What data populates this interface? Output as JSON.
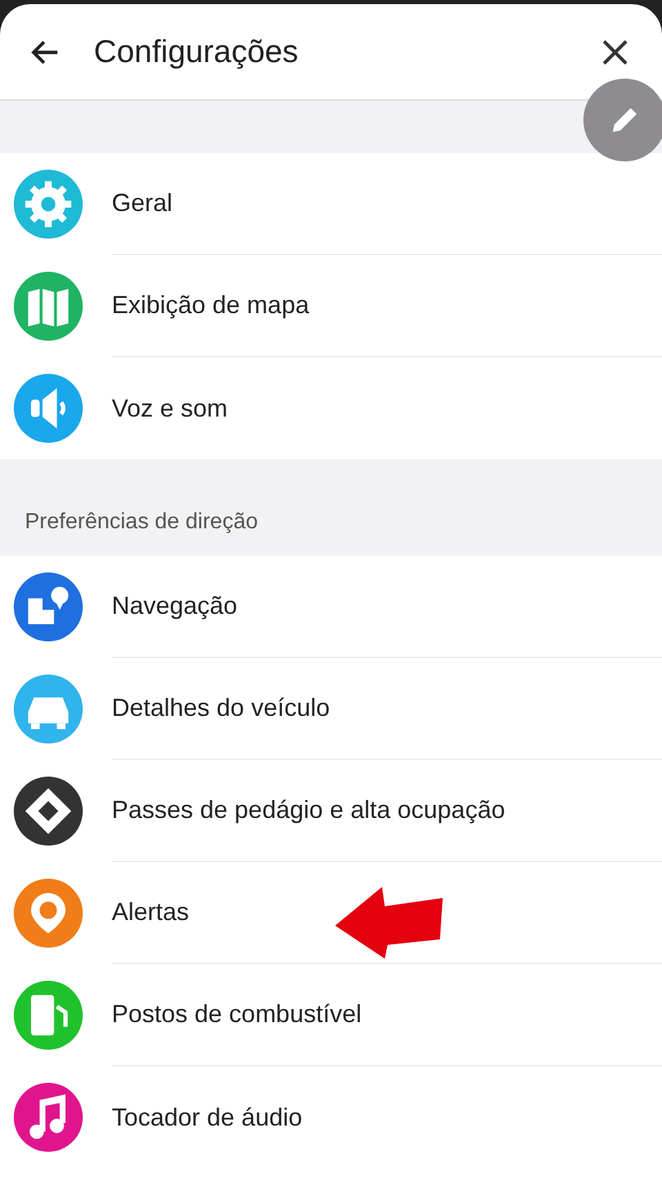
{
  "header": {
    "title": "Configurações"
  },
  "sections": [
    {
      "items": [
        {
          "label": "Geral",
          "color": "#1fbad6"
        },
        {
          "label": "Exibição de mapa",
          "color": "#1fb463"
        },
        {
          "label": "Voz e som",
          "color": "#1aa7ec"
        }
      ]
    },
    {
      "title": "Preferências de direção",
      "items": [
        {
          "label": "Navegação",
          "color": "#1f6fe0"
        },
        {
          "label": "Detalhes do veículo",
          "color": "#30b4ec"
        },
        {
          "label": "Passes de pedágio e alta ocupação",
          "color": "#333333"
        },
        {
          "label": "Alertas",
          "color": "#f07d18"
        },
        {
          "label": "Postos de combustível",
          "color": "#1fc22c"
        },
        {
          "label": "Tocador de áudio",
          "color": "#e0158e"
        }
      ]
    }
  ]
}
